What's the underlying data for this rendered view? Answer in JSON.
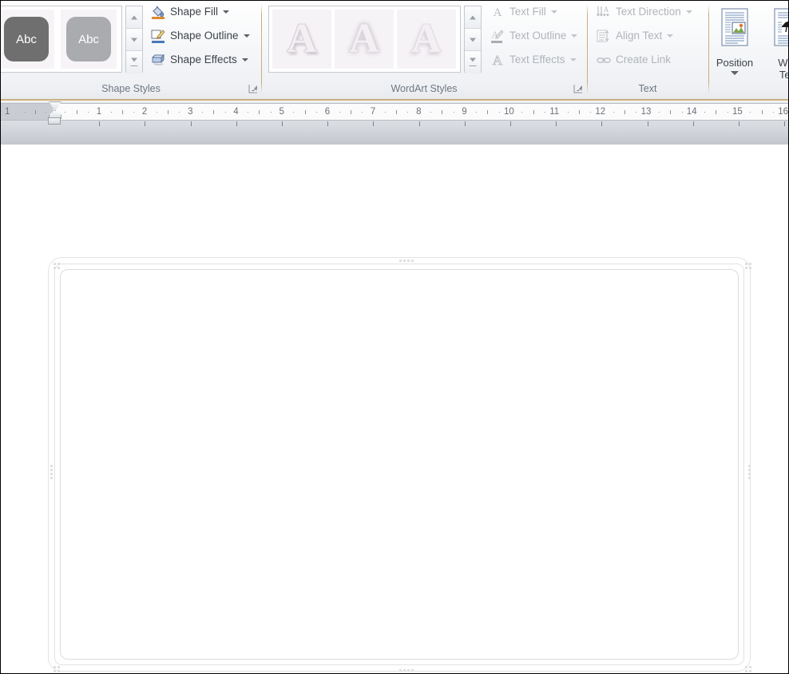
{
  "ribbon": {
    "groups": [
      {
        "name": "shape-styles",
        "label": "Shape Styles",
        "gallery_items": [
          {
            "label": "Abc",
            "variant": "dark"
          },
          {
            "label": "Abc",
            "variant": "light"
          }
        ],
        "buttons": [
          {
            "label": "Shape Fill",
            "icon": "paint-bucket-icon",
            "has_caret": true,
            "disabled": false
          },
          {
            "label": "Shape Outline",
            "icon": "pencil-outline-icon",
            "has_caret": true,
            "disabled": false
          },
          {
            "label": "Shape Effects",
            "icon": "shape-effects-icon",
            "has_caret": true,
            "disabled": false
          }
        ],
        "dialog_launcher": "shape-styles-dialog-launcher"
      },
      {
        "name": "wordart-styles",
        "label": "WordArt Styles",
        "gallery_items": [
          {
            "label": "A",
            "variant": "style-1"
          },
          {
            "label": "A",
            "variant": "style-2"
          },
          {
            "label": "A",
            "variant": "style-3"
          }
        ],
        "buttons": [
          {
            "label": "Text Fill",
            "icon": "text-fill-icon",
            "has_caret": true,
            "disabled": true
          },
          {
            "label": "Text Outline",
            "icon": "text-outline-icon",
            "has_caret": true,
            "disabled": true
          },
          {
            "label": "Text Effects",
            "icon": "text-effects-icon",
            "has_caret": true,
            "disabled": true
          }
        ],
        "dialog_launcher": "wordart-styles-dialog-launcher"
      },
      {
        "name": "text",
        "label": "Text",
        "buttons": [
          {
            "label": "Text Direction",
            "icon": "text-direction-icon",
            "has_caret": true,
            "disabled": true
          },
          {
            "label": "Align Text",
            "icon": "align-text-icon",
            "has_caret": true,
            "disabled": true
          },
          {
            "label": "Create Link",
            "icon": "create-link-icon",
            "has_caret": false,
            "disabled": true
          }
        ]
      },
      {
        "name": "arrange",
        "label": "",
        "big_buttons": [
          {
            "label": "Position",
            "icon": "position-icon",
            "has_caret": true
          },
          {
            "label": "Wrap Text",
            "label_line1": "Wra",
            "label_line2": "Tex",
            "icon": "wrap-text-icon",
            "has_caret": true
          }
        ]
      }
    ]
  },
  "ruler": {
    "name": "horizontal-ruler",
    "unit": "inch",
    "left_margin_label": "1",
    "ticks": [
      "1",
      "2",
      "3",
      "4",
      "5",
      "6",
      "7",
      "8",
      "9",
      "10",
      "11",
      "12",
      "13",
      "14",
      "15",
      "16"
    ],
    "indent_markers": [
      "first-line-indent-marker",
      "hanging-indent-marker",
      "left-indent-marker"
    ]
  },
  "canvas": {
    "name": "document-canvas",
    "selected_shape": {
      "name": "selected-text-box-shape",
      "type": "rounded-rectangle",
      "fill": "#ffffff",
      "outline": "#dcdcdc",
      "selected": true,
      "handles": [
        "top-left",
        "top-center",
        "top-right",
        "middle-left",
        "middle-right",
        "bottom-left",
        "bottom-center",
        "bottom-right"
      ]
    }
  },
  "colors": {
    "ribbon_accent": "#c9ae7b",
    "ribbon_bg": "#eef0f4",
    "ruler_bg": "#fbfbfc",
    "ruler_band": "#c9ccd2",
    "label_text": "#6f7781",
    "body_text": "#3d4349",
    "disabled_text": "#b0b4b9"
  }
}
